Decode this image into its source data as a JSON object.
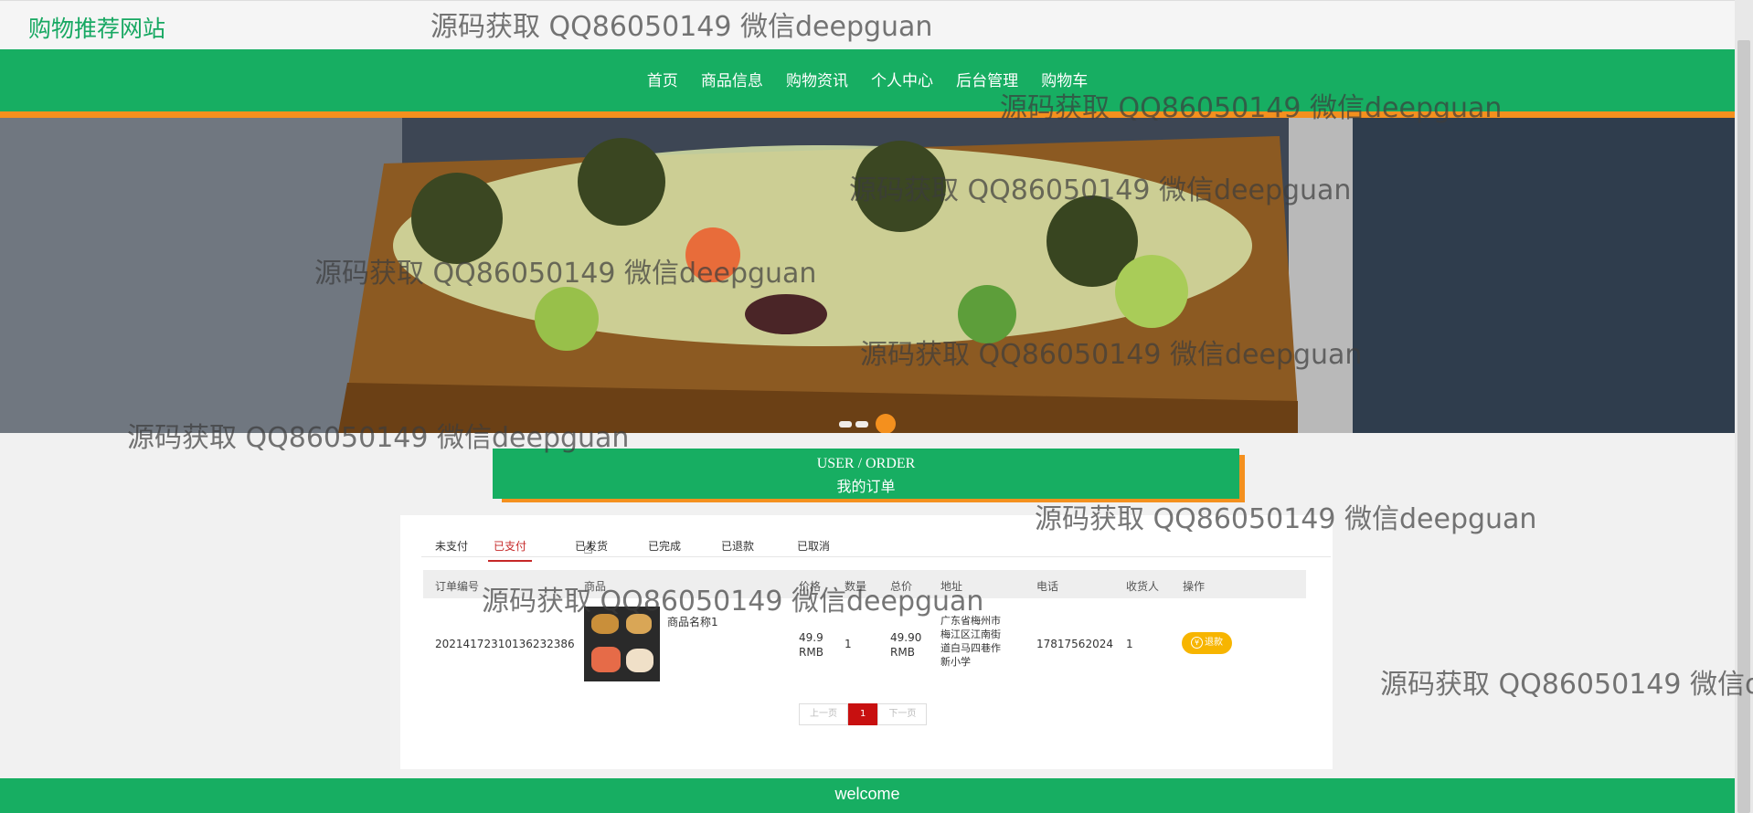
{
  "site": {
    "logo": "购物推荐网站"
  },
  "nav": {
    "items": [
      "首页",
      "商品信息",
      "购物资讯",
      "个人中心",
      "后台管理",
      "购物车"
    ]
  },
  "section_title": {
    "en": "USER / ORDER",
    "cn": "我的订单"
  },
  "tabs": [
    "未支付",
    "已支付",
    "已发货",
    "已完成",
    "已退款",
    "已取消"
  ],
  "active_tab": "已支付",
  "table": {
    "headers": [
      "订单编号",
      "商品",
      "价格",
      "数量",
      "总价",
      "地址",
      "电话",
      "收货人",
      "操作"
    ],
    "rows": [
      {
        "order_no": "20214172310136232386",
        "product_name": "商品名称1",
        "price_amount": "49.9",
        "price_unit": "RMB",
        "quantity": "1",
        "total_amount": "49.90",
        "total_unit": "RMB",
        "address": "广东省梅州市梅江区江南街道白马四巷作新小学",
        "phone": "17817562024",
        "receiver": "1",
        "action_label": "退款"
      }
    ]
  },
  "pagination": {
    "prev": "上一页",
    "current": "1",
    "next": "下一页"
  },
  "footer": {
    "text": "welcome"
  },
  "watermark": {
    "text": "源码获取 QQ86050149 微信deepguan"
  },
  "colors": {
    "brand_green": "#17ae62",
    "accent_orange": "#f4901e",
    "active_red": "#c62828"
  }
}
